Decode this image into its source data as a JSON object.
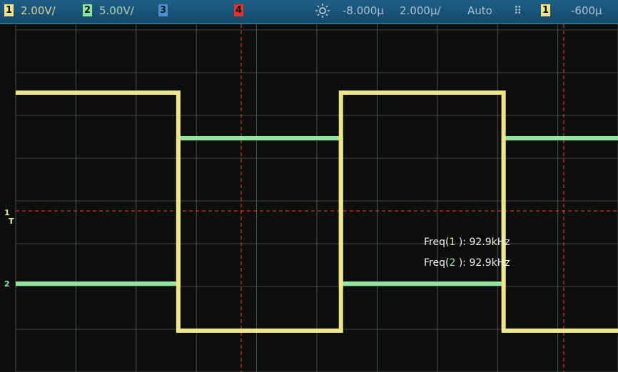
{
  "topbar": {
    "ch1_label": "1",
    "ch1_scale": "2.00V/",
    "ch2_label": "2",
    "ch2_scale": "5.00V/",
    "ch3_label": "3",
    "ch4_label": "4",
    "trigger_icon": "sun-brightness-icon",
    "time_delay": "-8.000µ",
    "time_scale": "2.000µ/",
    "trigger_mode": "Auto",
    "edge_icon": "rising-edge-icon",
    "trigger_source": "1",
    "trigger_level": "-600µ"
  },
  "markers": {
    "ch1": "1",
    "ch2": "2",
    "trig": "T"
  },
  "measurements": [
    {
      "prefix": "Freq(",
      "channel": "1",
      "suffix": " ): 92.9kHz"
    },
    {
      "prefix": "Freq(",
      "channel": "2",
      "suffix": " ): 92.9kHz"
    }
  ],
  "colors": {
    "ch1": "#f1e58a",
    "ch2": "#8ee8a2",
    "ch3": "#4f8fd0",
    "ch4": "#e1332f",
    "grid": "#5b5f5c",
    "background": "#0c0e0d"
  },
  "waveforms": {
    "ch1_edges_us": [
      -8.0,
      -2.6,
      2.8,
      8.2
    ],
    "ch2_edges_us": [
      -8.0,
      -2.6,
      2.8,
      8.2
    ]
  }
}
